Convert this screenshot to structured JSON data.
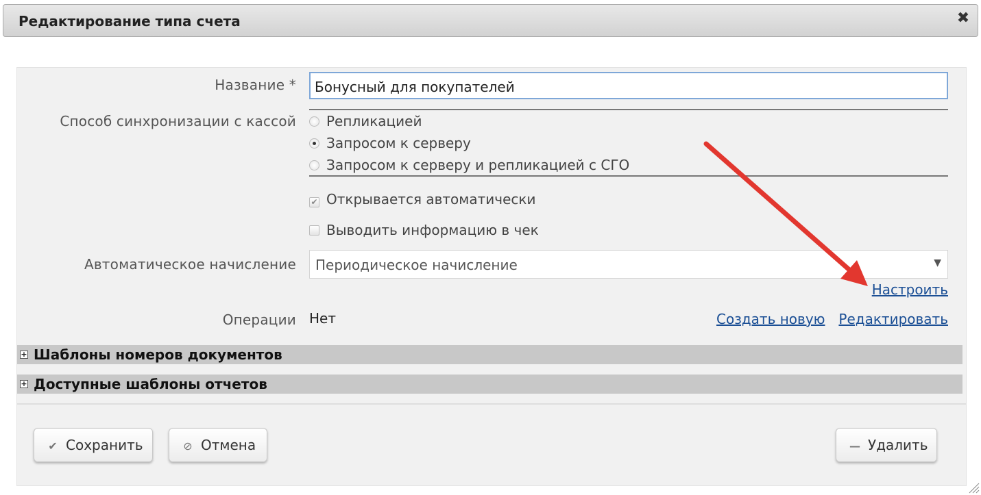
{
  "dialog": {
    "title": "Редактирование типа счета",
    "close_icon": "✖"
  },
  "form": {
    "name": {
      "label": "Название *",
      "value": "Бонусный для покупателей"
    },
    "sync": {
      "label": "Способ синхронизации с кассой",
      "options": [
        {
          "label": "Репликацией",
          "selected": false
        },
        {
          "label": "Запросом к серверу",
          "selected": true
        },
        {
          "label": "Запросом к серверу и репликацией с СГО",
          "selected": false
        }
      ]
    },
    "auto_open": {
      "label": "Открывается автоматически",
      "checked": true,
      "disabled": true
    },
    "print_receipt": {
      "label": "Выводить информацию в чек",
      "checked": false
    },
    "auto_accrual": {
      "label": "Автоматическое начисление",
      "value": "Периодическое начисление",
      "configure_link": "Настроить"
    },
    "operations": {
      "label": "Операции",
      "value": "Нет",
      "create_link": "Создать новую",
      "edit_link": "Редактировать"
    }
  },
  "sections": [
    {
      "title": "Шаблоны номеров документов",
      "icon": "expand-plus-icon"
    },
    {
      "title": "Доступные шаблоны отчетов",
      "icon": "expand-plus-icon"
    }
  ],
  "buttons": {
    "save": {
      "label": "Сохранить",
      "icon": "check-icon"
    },
    "cancel": {
      "label": "Отмена",
      "icon": "cancel-icon"
    },
    "delete": {
      "label": "Удалить",
      "icon": "minus-icon"
    }
  },
  "colors": {
    "link": "#1b4f95",
    "annotation_arrow": "#e2372f",
    "input_focus_border": "#7ea7d8"
  }
}
